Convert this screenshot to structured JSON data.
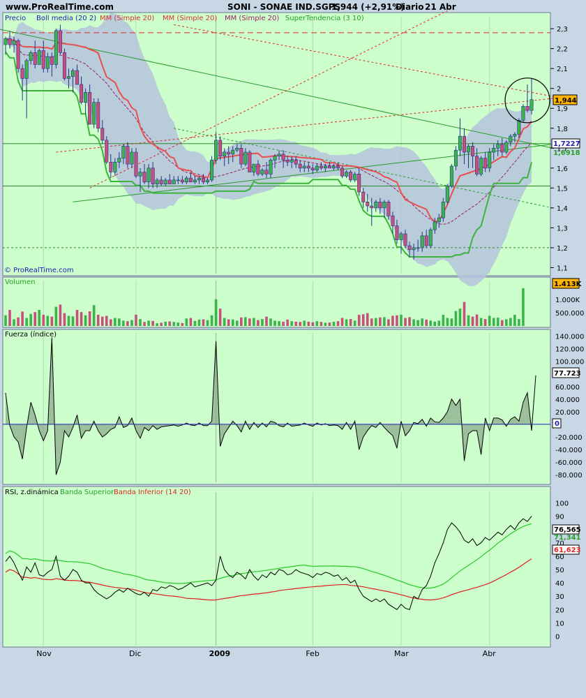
{
  "header": {
    "site": "www.ProRealTime.com",
    "title": "SONI - SONAE IND.SGPS",
    "quote": "1,944 (+2,91%)",
    "period": "Diario",
    "date": "21 Abr"
  },
  "watermark": "© ProRealTime.com",
  "colors": {
    "background": "#c8d7e6",
    "panel": "#ccffcc",
    "up_candle": "#3cb44b",
    "down_candle": "#c8507a",
    "boll_band": "#b4c3dc",
    "boll_mid": "#a01e64",
    "mm20": "#e85050",
    "supertrend": "#3cb43c",
    "price_label": "#ffb400",
    "resistance_line": "#dc2828"
  },
  "chart_data": [
    {
      "name": "price",
      "type": "candlestick",
      "legend": [
        "Precio",
        "Boll media (20 2)",
        "MM (Simple 20)",
        "MM (Simple 20)",
        "MM (Simple 20)",
        "SuperTendencia (3 10)"
      ],
      "ylim": [
        1.07,
        2.36
      ],
      "y_ticks": [
        "2,3",
        "2,2",
        "2,1",
        "2",
        "1,9",
        "1,8",
        "1,7",
        "1,6",
        "1,5",
        "1,4",
        "1,3",
        "1,2",
        "1,1"
      ],
      "x_ticks": [
        "Nov",
        "Dic",
        "2009",
        "Feb",
        "Mar",
        "Abr"
      ],
      "last_price": "1,944",
      "last_label_values": [
        "1,7227",
        "1,6918"
      ],
      "horizontal_levels": [
        2.28,
        1.7227,
        1.51,
        1.2
      ],
      "candles": [
        [
          2.22,
          2.26,
          2.17,
          2.25
        ],
        [
          2.25,
          2.29,
          2.2,
          2.22
        ],
        [
          2.22,
          2.26,
          2.18,
          2.24
        ],
        [
          2.24,
          2.25,
          2.08,
          2.1
        ],
        [
          2.1,
          2.12,
          1.94,
          2.05
        ],
        [
          2.05,
          2.15,
          1.85,
          2.14
        ],
        [
          2.14,
          2.19,
          2.12,
          2.18
        ],
        [
          2.18,
          2.24,
          2.1,
          2.12
        ],
        [
          2.12,
          2.2,
          2.12,
          2.19
        ],
        [
          2.19,
          2.24,
          2.08,
          2.1
        ],
        [
          2.1,
          2.18,
          2.08,
          2.16
        ],
        [
          2.16,
          2.18,
          2.06,
          2.12
        ],
        [
          2.12,
          2.3,
          2.1,
          2.29
        ],
        [
          2.29,
          2.32,
          2.17,
          2.18
        ],
        [
          2.18,
          2.2,
          2.04,
          2.05
        ],
        [
          2.05,
          2.1,
          2.0,
          2.06
        ],
        [
          2.06,
          2.1,
          1.98,
          2.09
        ],
        [
          2.09,
          2.12,
          2.02,
          2.02
        ],
        [
          2.02,
          2.06,
          1.92,
          1.93
        ],
        [
          1.93,
          2.0,
          1.87,
          1.98
        ],
        [
          1.98,
          2.02,
          1.82,
          1.82
        ],
        [
          1.82,
          1.95,
          1.8,
          1.93
        ],
        [
          1.93,
          1.95,
          1.78,
          1.8
        ],
        [
          1.8,
          1.84,
          1.72,
          1.74
        ],
        [
          1.74,
          1.76,
          1.62,
          1.63
        ],
        [
          1.63,
          1.67,
          1.55,
          1.58
        ],
        [
          1.58,
          1.65,
          1.56,
          1.63
        ],
        [
          1.63,
          1.68,
          1.6,
          1.65
        ],
        [
          1.65,
          1.72,
          1.62,
          1.71
        ],
        [
          1.71,
          1.73,
          1.6,
          1.62
        ],
        [
          1.62,
          1.7,
          1.6,
          1.68
        ],
        [
          1.68,
          1.7,
          1.55,
          1.56
        ],
        [
          1.56,
          1.6,
          1.48,
          1.58
        ],
        [
          1.58,
          1.62,
          1.52,
          1.53
        ],
        [
          1.53,
          1.62,
          1.5,
          1.6
        ],
        [
          1.6,
          1.63,
          1.5,
          1.52
        ],
        [
          1.52,
          1.55,
          1.5,
          1.54
        ],
        [
          1.54,
          1.56,
          1.51,
          1.52
        ],
        [
          1.52,
          1.55,
          1.51,
          1.54
        ],
        [
          1.54,
          1.57,
          1.52,
          1.52
        ],
        [
          1.52,
          1.56,
          1.52,
          1.54
        ],
        [
          1.54,
          1.56,
          1.52,
          1.54
        ],
        [
          1.54,
          1.56,
          1.52,
          1.53
        ],
        [
          1.53,
          1.56,
          1.52,
          1.55
        ],
        [
          1.55,
          1.58,
          1.53,
          1.53
        ],
        [
          1.53,
          1.56,
          1.52,
          1.54
        ],
        [
          1.54,
          1.56,
          1.52,
          1.55
        ],
        [
          1.55,
          1.57,
          1.52,
          1.53
        ],
        [
          1.53,
          1.55,
          1.52,
          1.54
        ],
        [
          1.54,
          1.66,
          1.53,
          1.64
        ],
        [
          1.64,
          1.78,
          1.62,
          1.74
        ],
        [
          1.74,
          1.76,
          1.64,
          1.66
        ],
        [
          1.66,
          1.7,
          1.61,
          1.68
        ],
        [
          1.68,
          1.71,
          1.62,
          1.67
        ],
        [
          1.67,
          1.71,
          1.63,
          1.69
        ],
        [
          1.69,
          1.72,
          1.68,
          1.7
        ],
        [
          1.7,
          1.72,
          1.6,
          1.62
        ],
        [
          1.62,
          1.7,
          1.61,
          1.68
        ],
        [
          1.68,
          1.69,
          1.58,
          1.58
        ],
        [
          1.58,
          1.62,
          1.56,
          1.62
        ],
        [
          1.62,
          1.64,
          1.56,
          1.57
        ],
        [
          1.57,
          1.6,
          1.56,
          1.59
        ],
        [
          1.59,
          1.63,
          1.55,
          1.57
        ],
        [
          1.57,
          1.65,
          1.55,
          1.64
        ],
        [
          1.64,
          1.67,
          1.6,
          1.66
        ],
        [
          1.66,
          1.69,
          1.64,
          1.67
        ],
        [
          1.67,
          1.69,
          1.6,
          1.64
        ],
        [
          1.64,
          1.66,
          1.61,
          1.63
        ],
        [
          1.63,
          1.66,
          1.6,
          1.64
        ],
        [
          1.64,
          1.66,
          1.6,
          1.62
        ],
        [
          1.62,
          1.64,
          1.58,
          1.6
        ],
        [
          1.6,
          1.63,
          1.58,
          1.61
        ],
        [
          1.61,
          1.63,
          1.58,
          1.6
        ],
        [
          1.6,
          1.62,
          1.57,
          1.59
        ],
        [
          1.59,
          1.62,
          1.58,
          1.61
        ],
        [
          1.61,
          1.63,
          1.59,
          1.6
        ],
        [
          1.6,
          1.62,
          1.58,
          1.61
        ],
        [
          1.61,
          1.63,
          1.6,
          1.6
        ],
        [
          1.6,
          1.62,
          1.59,
          1.61
        ],
        [
          1.61,
          1.63,
          1.59,
          1.6
        ],
        [
          1.6,
          1.61,
          1.55,
          1.56
        ],
        [
          1.56,
          1.59,
          1.55,
          1.58
        ],
        [
          1.58,
          1.59,
          1.53,
          1.54
        ],
        [
          1.54,
          1.58,
          1.53,
          1.57
        ],
        [
          1.57,
          1.6,
          1.46,
          1.48
        ],
        [
          1.48,
          1.5,
          1.4,
          1.43
        ],
        [
          1.43,
          1.47,
          1.38,
          1.41
        ],
        [
          1.41,
          1.45,
          1.31,
          1.4
        ],
        [
          1.4,
          1.44,
          1.38,
          1.43
        ],
        [
          1.43,
          1.45,
          1.37,
          1.4
        ],
        [
          1.4,
          1.44,
          1.35,
          1.43
        ],
        [
          1.43,
          1.44,
          1.34,
          1.36
        ],
        [
          1.36,
          1.38,
          1.27,
          1.31
        ],
        [
          1.31,
          1.34,
          1.22,
          1.24
        ],
        [
          1.24,
          1.28,
          1.17,
          1.27
        ],
        [
          1.27,
          1.29,
          1.2,
          1.21
        ],
        [
          1.21,
          1.23,
          1.15,
          1.19
        ],
        [
          1.19,
          1.22,
          1.14,
          1.2
        ],
        [
          1.2,
          1.24,
          1.18,
          1.2
        ],
        [
          1.2,
          1.28,
          1.18,
          1.26
        ],
        [
          1.26,
          1.29,
          1.2,
          1.21
        ],
        [
          1.21,
          1.3,
          1.2,
          1.29
        ],
        [
          1.29,
          1.35,
          1.27,
          1.33
        ],
        [
          1.33,
          1.37,
          1.3,
          1.35
        ],
        [
          1.35,
          1.45,
          1.33,
          1.43
        ],
        [
          1.43,
          1.52,
          1.42,
          1.51
        ],
        [
          1.51,
          1.62,
          1.5,
          1.61
        ],
        [
          1.61,
          1.71,
          1.59,
          1.69
        ],
        [
          1.69,
          1.85,
          1.66,
          1.76
        ],
        [
          1.76,
          1.8,
          1.62,
          1.68
        ],
        [
          1.68,
          1.72,
          1.6,
          1.71
        ],
        [
          1.71,
          1.73,
          1.6,
          1.66
        ],
        [
          1.66,
          1.7,
          1.56,
          1.57
        ],
        [
          1.57,
          1.66,
          1.56,
          1.65
        ],
        [
          1.65,
          1.68,
          1.58,
          1.6
        ],
        [
          1.6,
          1.7,
          1.58,
          1.68
        ],
        [
          1.68,
          1.72,
          1.64,
          1.7
        ],
        [
          1.7,
          1.74,
          1.66,
          1.72
        ],
        [
          1.72,
          1.75,
          1.66,
          1.68
        ],
        [
          1.68,
          1.74,
          1.67,
          1.73
        ],
        [
          1.73,
          1.77,
          1.71,
          1.76
        ],
        [
          1.76,
          1.78,
          1.73,
          1.77
        ],
        [
          1.77,
          1.85,
          1.75,
          1.84
        ],
        [
          1.84,
          1.92,
          1.83,
          1.91
        ],
        [
          1.91,
          2.02,
          1.88,
          1.89
        ],
        [
          1.89,
          2.05,
          1.87,
          1.944
        ]
      ]
    },
    {
      "name": "volume",
      "type": "bar",
      "label": "Volumen",
      "y_ticks": [
        "1.000K",
        "500.000"
      ],
      "last_label": "1.413K",
      "ylim": [
        0,
        1700
      ],
      "values": [
        400,
        600,
        250,
        320,
        540,
        300,
        450,
        520,
        600,
        420,
        380,
        350,
        720,
        800,
        480,
        380,
        360,
        600,
        520,
        400,
        550,
        780,
        420,
        350,
        380,
        250,
        300,
        280,
        200,
        180,
        220,
        420,
        260,
        150,
        200,
        190,
        100,
        120,
        160,
        170,
        150,
        130,
        110,
        280,
        300,
        190,
        240,
        250,
        220,
        400,
        1000,
        650,
        300,
        250,
        240,
        200,
        320,
        330,
        280,
        300,
        220,
        260,
        350,
        280,
        200,
        180,
        160,
        240,
        180,
        160,
        150,
        200,
        160,
        140,
        180,
        150,
        120,
        130,
        160,
        180,
        300,
        250,
        260,
        200,
        420,
        440,
        480,
        280,
        300,
        320,
        330,
        250,
        380,
        400,
        420,
        300,
        330,
        250,
        220,
        280,
        240,
        200,
        160,
        200,
        420,
        300,
        280,
        560,
        650,
        900,
        400,
        350,
        430,
        300,
        260,
        380,
        300,
        310,
        220,
        250,
        300,
        420,
        260,
        1413
      ]
    },
    {
      "name": "force_index",
      "type": "area",
      "label": "Fuerza (índice)",
      "ylim": [
        -92000,
        145000
      ],
      "y_ticks": [
        "140.000",
        "120.000",
        "100.000",
        "80.000",
        "60.000",
        "40.000",
        "20.000",
        "0",
        "-20.000",
        "-40.000",
        "-60.000",
        "-80.000"
      ],
      "last_label": "77.723",
      "zero_label": "0",
      "values": [
        50000,
        -2000,
        -20000,
        -28000,
        -55000,
        -5000,
        35000,
        15000,
        -10000,
        -26000,
        -10000,
        138000,
        -80000,
        -60000,
        -10000,
        -20000,
        -5000,
        15000,
        -22000,
        -10000,
        -10000,
        5000,
        -10000,
        -20000,
        -15000,
        -8000,
        -5000,
        12000,
        -5000,
        -2000,
        10000,
        -10000,
        -22000,
        -5000,
        -10000,
        -2000,
        -8000,
        -4000,
        -3000,
        -2000,
        -1000,
        -3000,
        -1000,
        2000,
        -1000,
        -2000,
        2000,
        -2000,
        -2000,
        5000,
        132000,
        -35000,
        -15000,
        -5000,
        5000,
        -2000,
        -12000,
        5000,
        -8000,
        3000,
        -5000,
        2000,
        -4000,
        5000,
        3000,
        -2000,
        -4000,
        2000,
        -3000,
        -2000,
        -1000,
        2000,
        -1000,
        -3000,
        2000,
        -1000,
        1000,
        -2000,
        -1000,
        -2000,
        -8000,
        3000,
        -8000,
        5000,
        -40000,
        -20000,
        -10000,
        -2000,
        -5000,
        3000,
        -5000,
        -12000,
        -18000,
        -38000,
        5000,
        -18000,
        -10000,
        3000,
        1000,
        8000,
        -3000,
        10000,
        4000,
        3000,
        10000,
        20000,
        40000,
        30000,
        40000,
        -58000,
        -15000,
        -10000,
        -10000,
        -48000,
        10000,
        -10000,
        10000,
        10000,
        7000,
        -3000,
        8000,
        12000,
        5000,
        35000,
        50000,
        -10000,
        77723
      ]
    },
    {
      "name": "rsi",
      "type": "line",
      "label": "RSI, z.dinámica",
      "band_labels": [
        "Banda Superior",
        "Banda Inferior (14 20)"
      ],
      "ylim": [
        -7,
        108
      ],
      "y_ticks": [
        "100",
        "90",
        "80",
        "70",
        "60",
        "50",
        "40",
        "30",
        "20",
        "10",
        "0"
      ],
      "last_labels": [
        "76,565",
        "71,341",
        "61,623"
      ],
      "rsi": [
        56,
        60,
        55,
        48,
        42,
        52,
        48,
        55,
        46,
        45,
        48,
        50,
        60,
        45,
        42,
        45,
        50,
        48,
        42,
        40,
        40,
        35,
        32,
        30,
        28,
        30,
        33,
        35,
        33,
        36,
        34,
        32,
        31,
        33,
        30,
        35,
        34,
        37,
        36,
        38,
        37,
        35,
        36,
        38,
        40,
        37,
        38,
        39,
        40,
        38,
        42,
        60,
        50,
        46,
        44,
        48,
        46,
        43,
        50,
        45,
        42,
        46,
        44,
        48,
        46,
        50,
        49,
        46,
        47,
        50,
        48,
        47,
        46,
        44,
        47,
        46,
        48,
        47,
        45,
        46,
        42,
        44,
        40,
        42,
        35,
        30,
        28,
        26,
        28,
        26,
        28,
        24,
        22,
        20,
        24,
        21,
        20,
        30,
        28,
        35,
        38,
        45,
        55,
        62,
        70,
        80,
        85,
        82,
        78,
        72,
        70,
        73,
        68,
        70,
        74,
        72,
        75,
        78,
        76,
        80,
        83,
        80,
        85,
        88,
        86,
        90
      ]
    }
  ]
}
